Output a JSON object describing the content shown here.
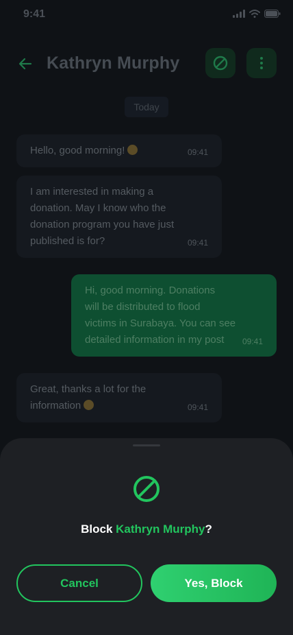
{
  "status_bar": {
    "time": "9:41"
  },
  "header": {
    "title": "Kathryn Murphy"
  },
  "date_divider": "Today",
  "messages": [
    {
      "direction": "incoming",
      "lines": [
        "Hello, good morning!"
      ],
      "emoji": "grinning-face",
      "time": "09:41"
    },
    {
      "direction": "incoming",
      "lines": [
        "I am interested in making a",
        "donation. May I know who the",
        "donation program you have just",
        "published is for?"
      ],
      "time": "09:41"
    },
    {
      "direction": "outgoing",
      "lines": [
        "Hi, good morning. Donations",
        "will be distributed to flood",
        "victims in Surabaya. You can see",
        "detailed information in my post"
      ],
      "time": "09:41"
    },
    {
      "direction": "incoming",
      "lines": [
        "Great, thanks a lot for the",
        "information"
      ],
      "emoji": "grinning-face",
      "time": "09:41"
    }
  ],
  "sheet": {
    "title_prefix": "Block ",
    "title_name": "Kathryn Murphy",
    "title_suffix": "?",
    "cancel_label": "Cancel",
    "confirm_label": "Yes, Block"
  },
  "colors": {
    "accent": "#22c55e",
    "background": "#0f1216",
    "sheet": "#1e2024",
    "outgoing_bubble": "#0e4f31"
  },
  "icons": {
    "back": "arrow-left-icon",
    "block": "block-icon",
    "more": "more-vertical-icon",
    "signal": "signal-icon",
    "wifi": "wifi-icon",
    "battery": "battery-icon"
  }
}
